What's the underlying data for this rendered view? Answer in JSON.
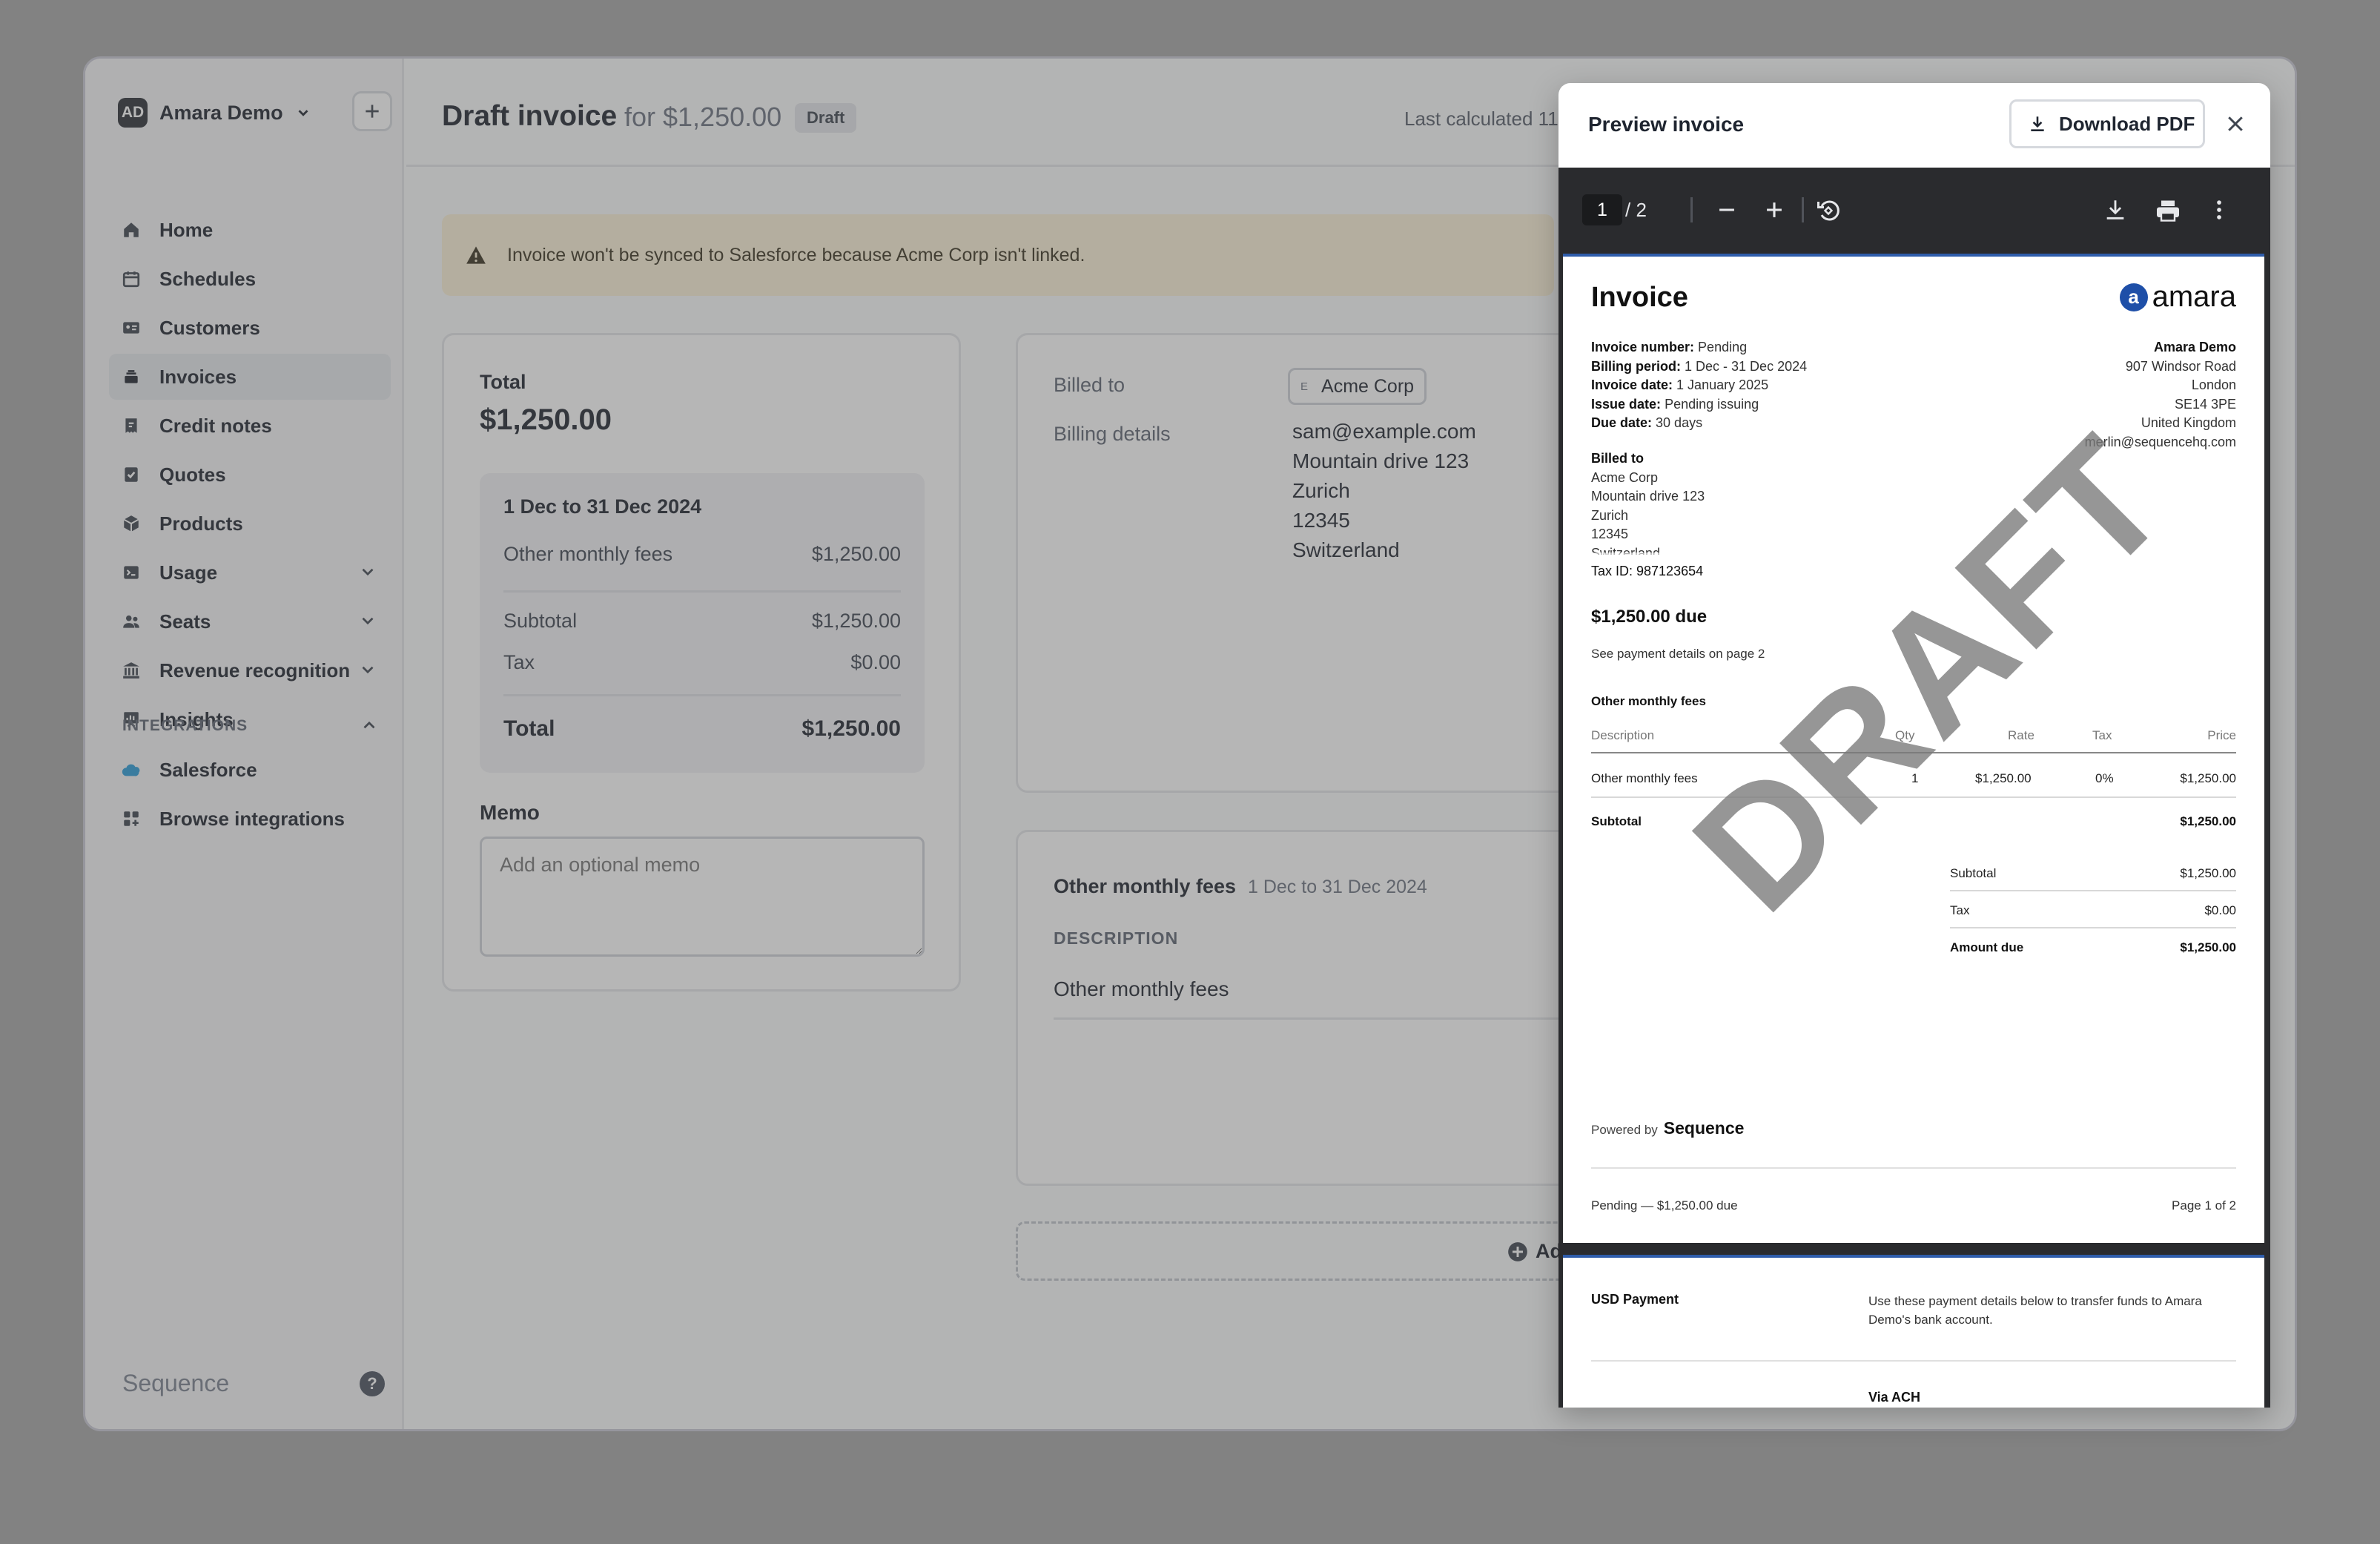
{
  "sidebar": {
    "workspace": {
      "initials": "AD",
      "name": "Amara Demo"
    },
    "items": [
      {
        "label": "Home",
        "icon": "home-icon"
      },
      {
        "label": "Schedules",
        "icon": "calendar-icon"
      },
      {
        "label": "Customers",
        "icon": "id-card-icon"
      },
      {
        "label": "Invoices",
        "icon": "stack-icon",
        "active": true
      },
      {
        "label": "Credit notes",
        "icon": "credit-note-icon"
      },
      {
        "label": "Quotes",
        "icon": "check-doc-icon"
      },
      {
        "label": "Products",
        "icon": "box-icon"
      },
      {
        "label": "Usage",
        "icon": "terminal-icon"
      },
      {
        "label": "Seats",
        "icon": "users-icon"
      },
      {
        "label": "Revenue recognition",
        "icon": "bank-icon"
      },
      {
        "label": "Insights",
        "icon": "chart-icon"
      }
    ],
    "integrations_label": "INTEGRATIONS",
    "integrations": [
      {
        "label": "Salesforce",
        "icon": "salesforce-cloud-icon"
      },
      {
        "label": "Browse integrations",
        "icon": "grid-plus-icon"
      }
    ],
    "footer_brand": "Sequence",
    "help": "?"
  },
  "header": {
    "title": "Draft invoice",
    "subtitle": "for $1,250.00",
    "badge": "Draft",
    "last_calculated": "Last calculated 11"
  },
  "banner": {
    "text": "Invoice won't be synced to Salesforce because Acme Corp isn't linked."
  },
  "total_card": {
    "label": "Total",
    "amount": "$1,250.00",
    "period": "1 Dec to 31 Dec 2024",
    "line_label": "Other monthly fees",
    "line_value": "$1,250.00",
    "subtotal_label": "Subtotal",
    "subtotal_value": "$1,250.00",
    "tax_label": "Tax",
    "tax_value": "$0.00",
    "total_label": "Total",
    "total_value": "$1,250.00",
    "memo_label": "Memo",
    "memo_placeholder": "Add an optional memo"
  },
  "billed_card": {
    "billed_to_label": "Billed to",
    "customer_initial": "E",
    "customer": "Acme Corp",
    "details_label": "Billing details",
    "email": "sam@example.com",
    "street": "Mountain drive 123",
    "city": "Zurich",
    "postcode": "12345",
    "country": "Switzerland"
  },
  "fees_card": {
    "title": "Other monthly fees",
    "period": "1 Dec to 31 Dec 2024",
    "column": "DESCRIPTION",
    "row": "Other monthly fees",
    "add_label": "Add l"
  },
  "preview": {
    "title": "Preview invoice",
    "download_label": "Download PDF",
    "viewer": {
      "page": "1",
      "of": "/  2"
    },
    "doc": {
      "heading": "Invoice",
      "logo_letter": "a",
      "logo_text": "amara",
      "meta": [
        {
          "k": "Invoice number:",
          "v": "Pending"
        },
        {
          "k": "Billing period:",
          "v": "1 Dec - 31 Dec 2024"
        },
        {
          "k": "Invoice date:",
          "v": "1 January 2025"
        },
        {
          "k": "Issue date:",
          "v": "Pending issuing"
        },
        {
          "k": "Due date:",
          "v": "30 days"
        }
      ],
      "from": [
        "Amara Demo",
        "907 Windsor Road",
        "London",
        "SE14 3PE",
        "United Kingdom",
        "merlin@sequencehq.com"
      ],
      "billed_to_label": "Billed to",
      "billed_to": [
        "Acme Corp",
        "Mountain drive 123",
        "Zurich",
        "12345",
        "Switzerland"
      ],
      "tax_id": "Tax ID: 987123654",
      "due": "$1,250.00 due",
      "see_payment": "See payment details on page 2",
      "section": "Other monthly fees",
      "cols": {
        "desc": "Description",
        "qty": "Qty",
        "rate": "Rate",
        "tax": "Tax",
        "price": "Price"
      },
      "line": {
        "desc": "Other monthly fees",
        "qty": "1",
        "rate": "$1,250.00",
        "tax": "0%",
        "price": "$1,250.00"
      },
      "section_subtotal_label": "Subtotal",
      "section_subtotal": "$1,250.00",
      "sum_subtotal_label": "Subtotal",
      "sum_subtotal": "$1,250.00",
      "sum_tax_label": "Tax",
      "sum_tax": "$0.00",
      "sum_due_label": "Amount due",
      "sum_due": "$1,250.00",
      "watermark": "DRAFT",
      "powered_by": "Powered by",
      "powered_brand": "Sequence",
      "footer_left": "Pending — $1,250.00 due",
      "footer_right": "Page 1 of 2",
      "p2_heading": "USD Payment",
      "p2_text": "Use these payment details below to transfer funds to Amara Demo's bank account.",
      "p2_via": "Via ACH"
    }
  }
}
